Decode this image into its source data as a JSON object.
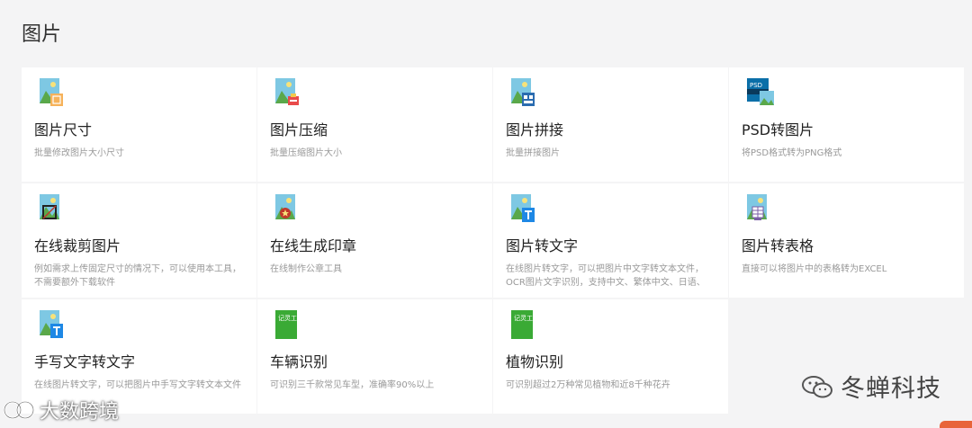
{
  "page": {
    "title": "图片"
  },
  "cards": [
    {
      "title": "图片尺寸",
      "desc": "批量修改图片大小尺寸",
      "icon": "image-resize-icon"
    },
    {
      "title": "图片压缩",
      "desc": "批量压缩图片大小",
      "icon": "image-compress-icon"
    },
    {
      "title": "图片拼接",
      "desc": "批量拼接图片",
      "icon": "image-stitch-icon"
    },
    {
      "title": "PSD转图片",
      "desc": "将PSD格式转为PNG格式",
      "icon": "psd-to-image-icon",
      "icon_label": "PSD"
    },
    {
      "title": "在线裁剪图片",
      "desc": "例如需求上传固定尺寸的情况下，可以使用本工具，不需要额外下载软件",
      "icon": "image-crop-icon"
    },
    {
      "title": "在线生成印章",
      "desc": "在线制作公章工具",
      "icon": "seal-generator-icon"
    },
    {
      "title": "图片转文字",
      "desc": "在线图片转文字，可以把图片中文字转文本文件，OCR图片文字识别，支持中文、繁体中文、日语、",
      "icon": "image-to-text-icon"
    },
    {
      "title": "图片转表格",
      "desc": "直接可以将图片中的表格转为EXCEL",
      "icon": "image-to-table-icon"
    },
    {
      "title": "手写文字转文字",
      "desc": "在线图片转文字，可以把图片中手写文字转文本文件",
      "icon": "handwriting-to-text-icon"
    },
    {
      "title": "车辆识别",
      "desc": "可识别三千款常见车型，准确率90%以上",
      "icon": "vehicle-recognition-icon",
      "icon_label": "记灵工具"
    },
    {
      "title": "植物识别",
      "desc": "可识别超过2万种常见植物和近8千种花卉",
      "icon": "plant-recognition-icon",
      "icon_label": "记灵工具"
    }
  ],
  "watermarks": {
    "right": "冬蝉科技",
    "left": "大数跨境"
  },
  "colors": {
    "background": "#f4f4f5",
    "card": "#ffffff",
    "title": "#222222",
    "desc": "#999999",
    "green_badge": "#3aaa35"
  }
}
